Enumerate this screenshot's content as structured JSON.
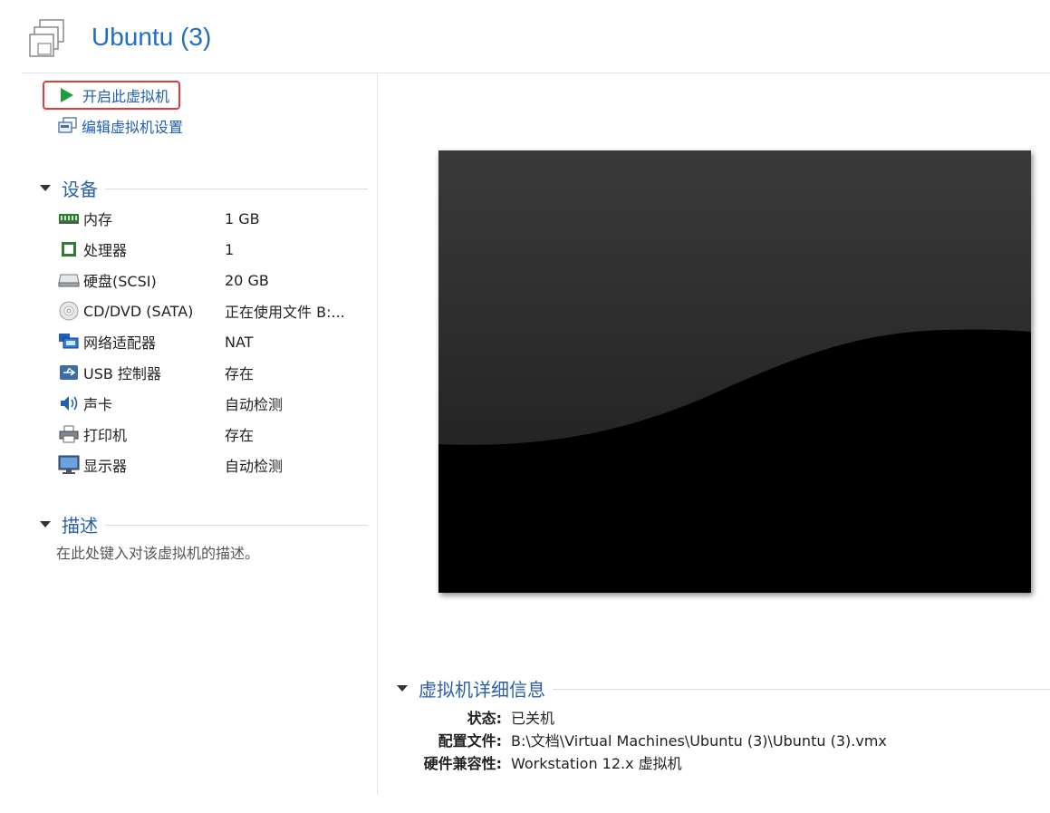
{
  "header": {
    "title": "Ubuntu (3)",
    "icon": "vm-icon"
  },
  "actions": {
    "power_on": "开启此虚拟机",
    "edit_settings": "编辑虚拟机设置"
  },
  "devices": {
    "title": "设备",
    "items": [
      {
        "name": "内存",
        "value": "1 GB",
        "icon": "memory-icon"
      },
      {
        "name": "处理器",
        "value": "1",
        "icon": "processor-icon"
      },
      {
        "name": "硬盘(SCSI)",
        "value": "20 GB",
        "icon": "hard-disk-icon"
      },
      {
        "name": "CD/DVD (SATA)",
        "value": "正在使用文件 B:...",
        "icon": "cd-dvd-icon"
      },
      {
        "name": "网络适配器",
        "value": "NAT",
        "icon": "network-adapter-icon"
      },
      {
        "name": "USB 控制器",
        "value": "存在",
        "icon": "usb-icon"
      },
      {
        "name": "声卡",
        "value": "自动检测",
        "icon": "sound-card-icon"
      },
      {
        "name": "打印机",
        "value": "存在",
        "icon": "printer-icon"
      },
      {
        "name": "显示器",
        "value": "自动检测",
        "icon": "display-icon"
      }
    ]
  },
  "description": {
    "title": "描述",
    "placeholder": "在此处键入对该虚拟机的描述。"
  },
  "details": {
    "title": "虚拟机详细信息",
    "rows": [
      {
        "label": "状态:",
        "value": "已关机"
      },
      {
        "label": "配置文件:",
        "value": "B:\\文档\\Virtual Machines\\Ubuntu (3)\\Ubuntu (3).vmx"
      },
      {
        "label": "硬件兼容性:",
        "value": "Workstation 12.x 虚拟机"
      }
    ]
  },
  "colors": {
    "accent": "#1f6fc5",
    "highlight_border": "#e23b3b",
    "play_green": "#1e9e3a"
  }
}
